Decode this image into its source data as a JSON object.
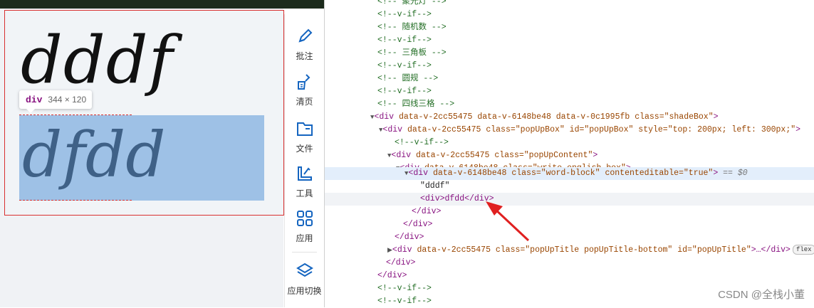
{
  "canvas": {
    "word_line1": "dddf",
    "word_line2": "dfdd",
    "tooltip": {
      "tag": "div",
      "size": "344 × 120"
    }
  },
  "toolbar": {
    "items": [
      {
        "label": "批注",
        "icon": "pen-icon"
      },
      {
        "label": "清页",
        "icon": "broom-icon"
      },
      {
        "label": "文件",
        "icon": "folder-icon"
      },
      {
        "label": "工具",
        "icon": "ruler-tools-icon"
      },
      {
        "label": "应用",
        "icon": "apps-grid-icon"
      },
      {
        "label": "应用切换",
        "icon": "layers-icon"
      }
    ]
  },
  "devtools": {
    "lines": [
      {
        "type": "comment",
        "text": "<!-- 聚光灯 -->"
      },
      {
        "type": "comment",
        "text": "<!--v-if-->"
      },
      {
        "type": "comment",
        "text": "<!-- 随机数 -->"
      },
      {
        "type": "comment",
        "text": "<!--v-if-->"
      },
      {
        "type": "comment",
        "text": "<!-- 三角板 -->"
      },
      {
        "type": "comment",
        "text": "<!--v-if-->"
      },
      {
        "type": "comment",
        "text": "<!-- 圆规 -->"
      },
      {
        "type": "comment",
        "text": "<!--v-if-->"
      },
      {
        "type": "comment",
        "text": "<!-- 四线三格 -->"
      },
      {
        "type": "open",
        "tag": "div",
        "attrs": "data-v-2cc55475 data-v-6148be48 data-v-0c1995fb class=\"shadeBox\""
      },
      {
        "type": "open",
        "tag": "div",
        "attrs": "data-v-2cc55475 class=\"popUpBox\" id=\"popUpBox\" style=\"top: 200px; left: 300px;\""
      },
      {
        "type": "comment",
        "text": "<!--v-if-->"
      },
      {
        "type": "open",
        "tag": "div",
        "attrs": "data-v-2cc55475 class=\"popUpContent\""
      },
      {
        "type": "open",
        "tag": "div",
        "attrs": "data-v-6148be48 class=\"write-english-box\""
      },
      {
        "type": "open",
        "tag": "div",
        "attrs": "data-v-6148be48 class=\"word-block\" contenteditable=\"true\"",
        "suffix": "== $0"
      },
      {
        "type": "text",
        "text": "\"dddf\""
      },
      {
        "type": "inline",
        "text": "<div>dfdd</div>"
      },
      {
        "type": "close",
        "text": "</div>"
      },
      {
        "type": "close",
        "text": "</div>"
      },
      {
        "type": "close",
        "text": "</div>"
      },
      {
        "type": "collapsed",
        "tag": "div",
        "attrs": "data-v-2cc55475 class=\"popUpTitle popUpTitle-bottom\" id=\"popUpTitle\"",
        "tail": "…</div>",
        "badge": "flex"
      },
      {
        "type": "close",
        "text": "</div>"
      },
      {
        "type": "close",
        "text": "</div>"
      },
      {
        "type": "comment",
        "text": "<!--v-if-->"
      },
      {
        "type": "comment",
        "text": "<!--v-if-->"
      }
    ]
  },
  "watermark": "CSDN @全栈小董",
  "colors": {
    "selection": "#9ec1e6",
    "border_red": "#d93030",
    "arrow": "#e02020"
  }
}
